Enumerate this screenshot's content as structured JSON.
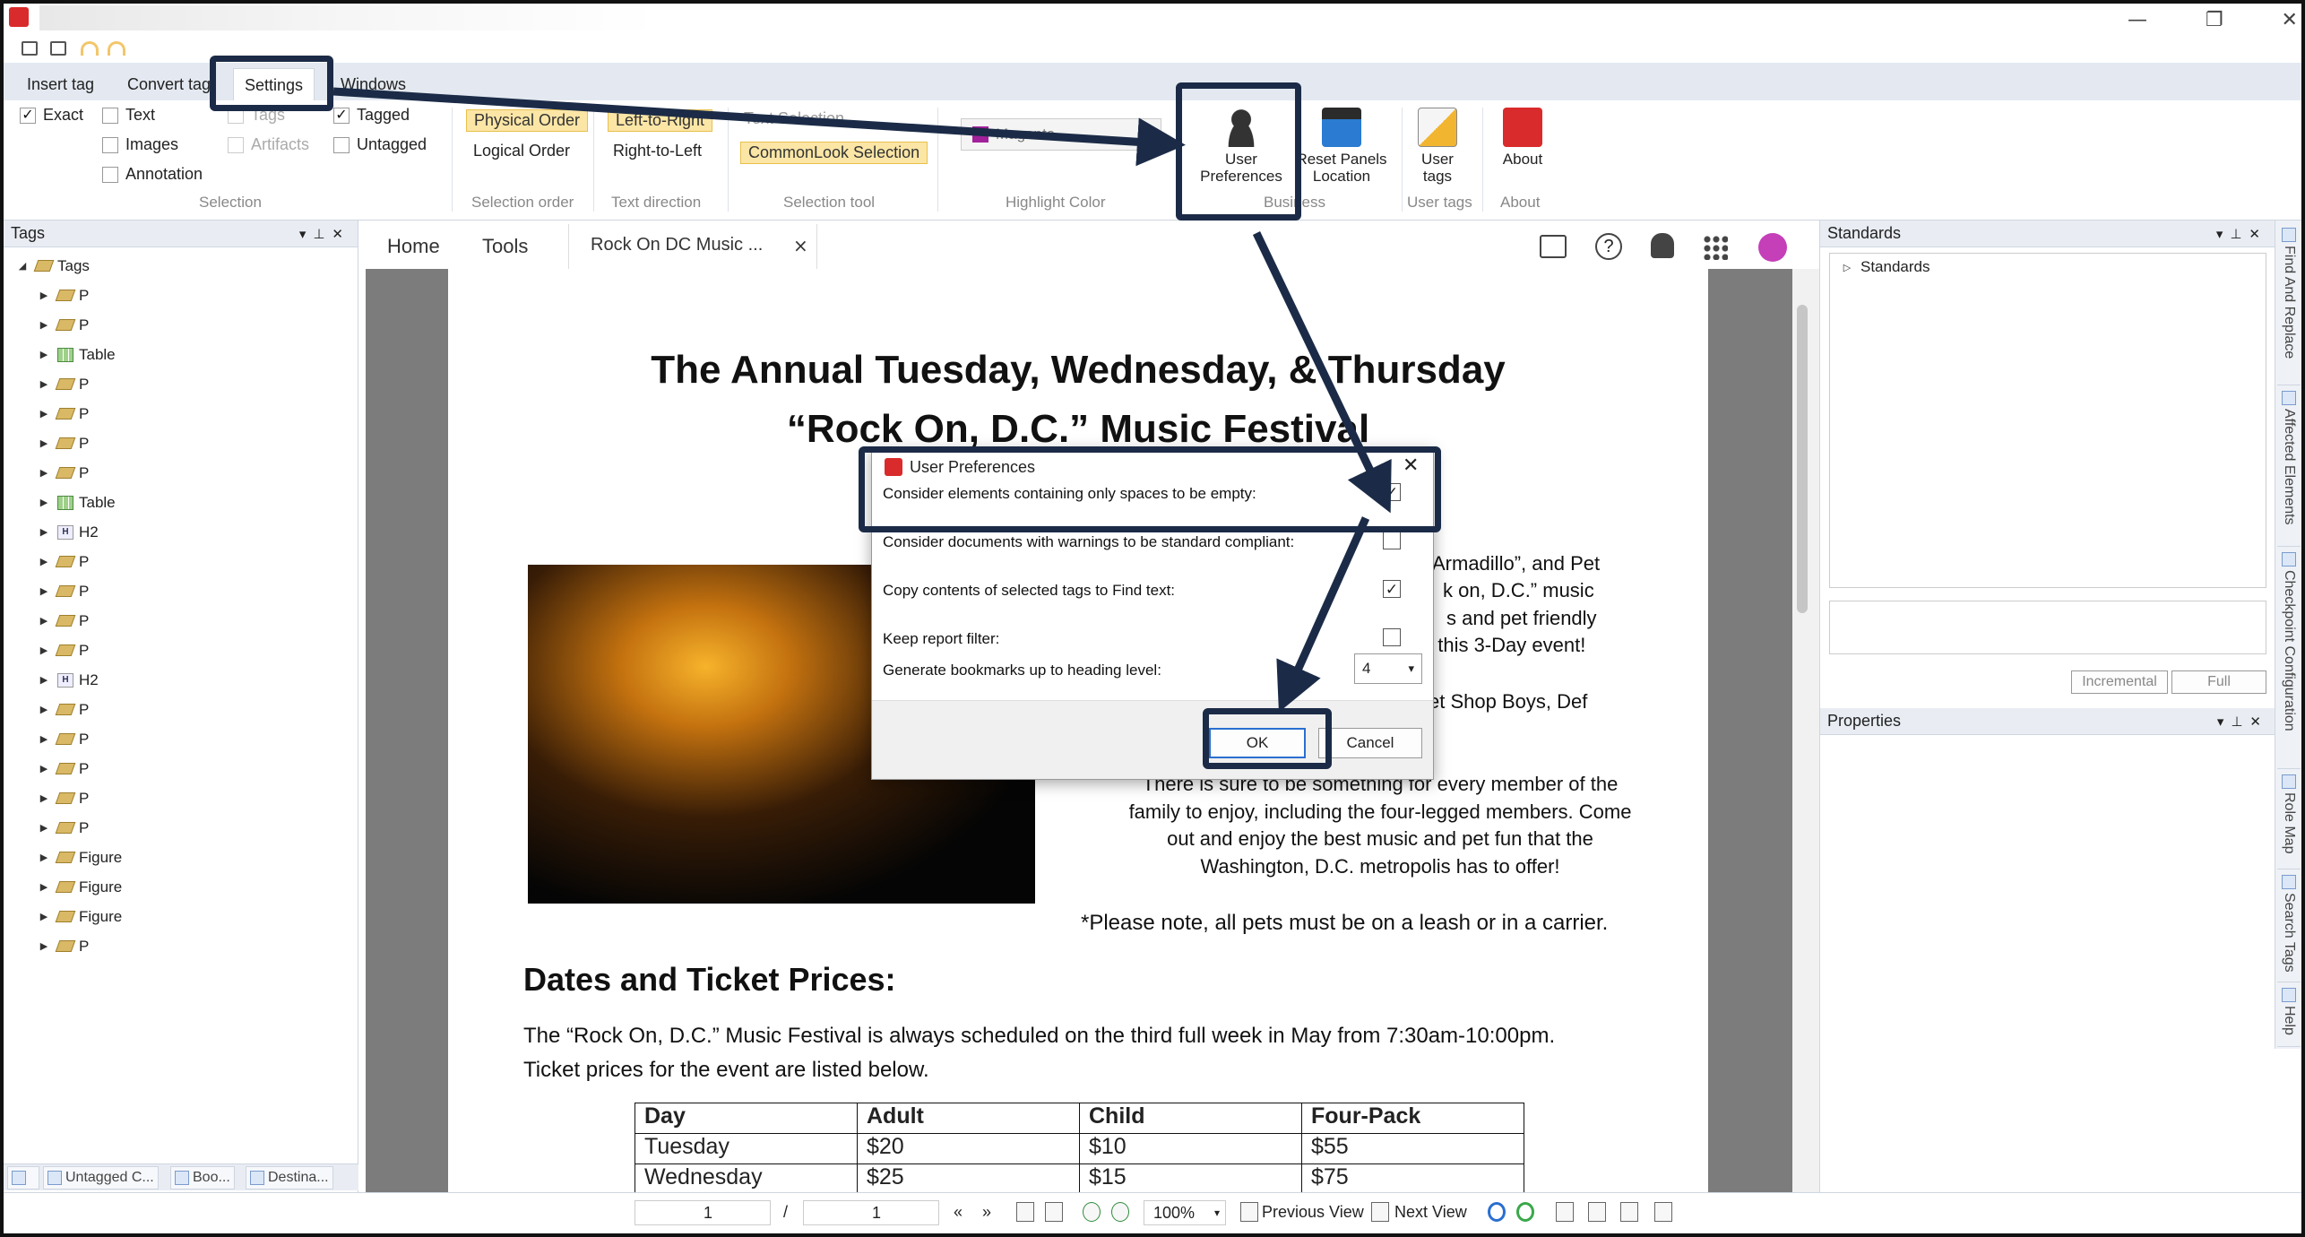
{
  "window": {
    "minimize": "—",
    "maximize": "❐",
    "close": "✕"
  },
  "menu": [
    "Insert tag",
    "Convert tag",
    "Settings",
    "Windows"
  ],
  "ribbon": {
    "selection": {
      "exact": "Exact",
      "text": "Text",
      "tags": "Tags",
      "tagged": "Tagged",
      "images": "Images",
      "artifacts": "Artifacts",
      "untagged": "Untagged",
      "annotation": "Annotation",
      "group_label": "Selection"
    },
    "order": {
      "physical": "Physical Order",
      "logical": "Logical Order",
      "group_label": "Selection order"
    },
    "direction": {
      "ltr": "Left-to-Right",
      "rtl": "Right-to-Left",
      "group_label": "Text direction"
    },
    "tool": {
      "text_sel": "Text Selection",
      "commonlook": "CommonLook Selection",
      "group_label": "Selection tool"
    },
    "highlight": {
      "value": "Magenta",
      "swatch": "#a2219b",
      "group_label": "Highlight Color"
    },
    "business": {
      "user_prefs_l1": "User",
      "user_prefs_l2": "Preferences",
      "reset_l1": "Reset Panels",
      "reset_l2": "Location",
      "group_label": "Business"
    },
    "usertags": {
      "l1": "User",
      "l2": "tags",
      "group_label": "User tags"
    },
    "about": {
      "label": "About",
      "group_label": "About"
    }
  },
  "tags_panel": {
    "title": "Tags",
    "root": "Tags",
    "items": [
      "P",
      "P",
      "Table",
      "P",
      "P",
      "P",
      "P",
      "Table",
      "H2",
      "P",
      "P",
      "P",
      "P",
      "H2",
      "P",
      "P",
      "P",
      "P",
      "P",
      "Figure",
      "Figure",
      "Figure",
      "P"
    ],
    "bottom_tabs": [
      "Untagged C...",
      "Boo...",
      "Destina..."
    ]
  },
  "doc_tabs": {
    "home": "Home",
    "tools": "Tools",
    "doc": "Rock On DC Music ...",
    "close": "×"
  },
  "document": {
    "title1": "The Annual Tuesday, Wednesday, & Thursday",
    "title2": "“Rock On, D.C.” Music Festival",
    "para1": [
      "Armadillo”, and Pet",
      "k on, D.C.” music",
      "s and pet friendly",
      "f this 3-Day event!"
    ],
    "para2": "et Shop Boys, Def",
    "para3": [
      "There is sure to be something for every member of the",
      "family to enjoy, including the four-legged members.  Come",
      "out and enjoy the best music and pet fun that the",
      "Washington, D.C. metropolis has to offer!"
    ],
    "note": "*Please note, all pets must be on a leash or in a carrier.",
    "heading": "Dates and Ticket Prices:",
    "body1": "The “Rock On, D.C.” Music Festival is always scheduled on the third full week in May from 7:30am-10:00pm.",
    "body2": "Ticket prices for the event are listed below.",
    "table": {
      "header": [
        "Day",
        "Adult",
        "Child",
        "Four-Pack"
      ],
      "rows": [
        [
          "Tuesday",
          "$20",
          "$10",
          "$55"
        ],
        [
          "Wednesday",
          "$25",
          "$15",
          "$75"
        ]
      ]
    }
  },
  "dialog": {
    "title": "User Preferences",
    "options": [
      {
        "label": "Consider elements containing only spaces to be empty:",
        "checked": true
      },
      {
        "label": "Consider documents with warnings to be standard compliant:",
        "checked": false
      },
      {
        "label": "Copy contents of selected tags to Find text:",
        "checked": true
      },
      {
        "label": "Keep report filter:",
        "checked": false
      }
    ],
    "heading_level_label": "Generate bookmarks up to heading level:",
    "heading_level_value": "4",
    "ok": "OK",
    "cancel": "Cancel"
  },
  "standards_panel": {
    "title": "Standards",
    "root": "Standards",
    "incremental": "Incremental",
    "full": "Full"
  },
  "properties_panel": {
    "title": "Properties"
  },
  "side_tabs": [
    "Find And Replace",
    "Affected Elements",
    "Checkpoint Configuration",
    "Role Map",
    "Search Tags",
    "Help"
  ],
  "status": {
    "page": "1",
    "slash": "/",
    "total": "1",
    "zoom": "100%",
    "prev_view": "Previous View",
    "next_view": "Next View"
  },
  "colors": {
    "accent_box": "#1b2b47",
    "ribbon_bg": "#e4e9f1",
    "app_red": "#d92b2b"
  }
}
